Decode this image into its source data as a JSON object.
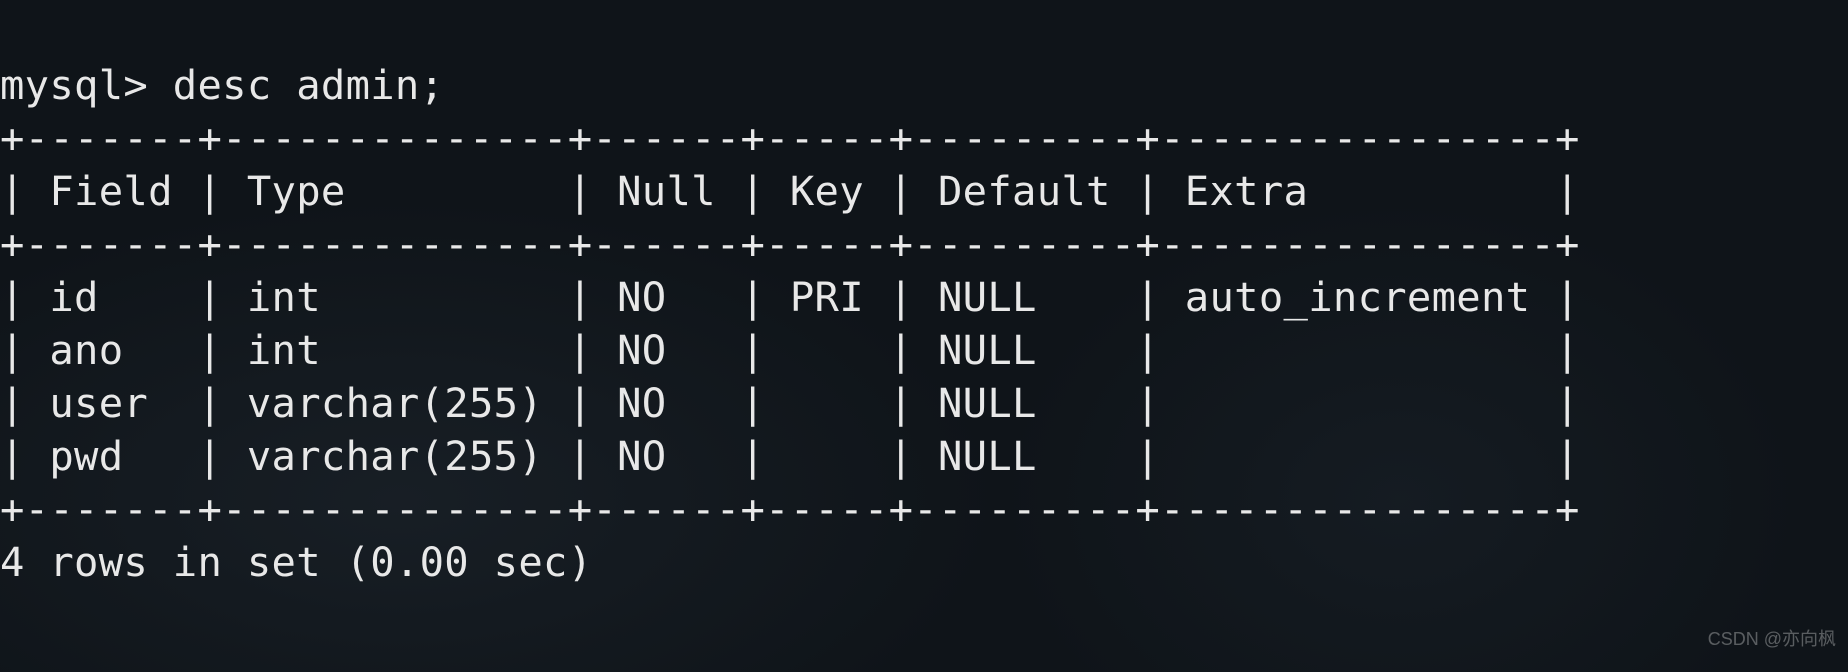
{
  "prompt_line": "mysql> desc admin;",
  "border_top": "+-------+--------------+------+-----+---------+----------------+",
  "border_mid": "+-------+--------------+------+-----+---------+----------------+",
  "border_bottom": "+-------+--------------+------+-----+---------+----------------+",
  "header_line": "| Field | Type         | Null | Key | Default | Extra          |",
  "row_lines": [
    "| id    | int          | NO   | PRI | NULL    | auto_increment |",
    "| ano   | int          | NO   |     | NULL    |                |",
    "| user  | varchar(255) | NO   |     | NULL    |                |",
    "| pwd   | varchar(255) | NO   |     | NULL    |                |"
  ],
  "footer_line": "4 rows in set (0.00 sec)",
  "watermark": "CSDN @亦向枫",
  "chart_data": {
    "type": "table",
    "title": "desc admin",
    "columns": [
      "Field",
      "Type",
      "Null",
      "Key",
      "Default",
      "Extra"
    ],
    "rows": [
      {
        "Field": "id",
        "Type": "int",
        "Null": "NO",
        "Key": "PRI",
        "Default": "NULL",
        "Extra": "auto_increment"
      },
      {
        "Field": "ano",
        "Type": "int",
        "Null": "NO",
        "Key": "",
        "Default": "NULL",
        "Extra": ""
      },
      {
        "Field": "user",
        "Type": "varchar(255)",
        "Null": "NO",
        "Key": "",
        "Default": "NULL",
        "Extra": ""
      },
      {
        "Field": "pwd",
        "Type": "varchar(255)",
        "Null": "NO",
        "Key": "",
        "Default": "NULL",
        "Extra": ""
      }
    ],
    "row_count": 4,
    "elapsed_sec": 0.0
  }
}
